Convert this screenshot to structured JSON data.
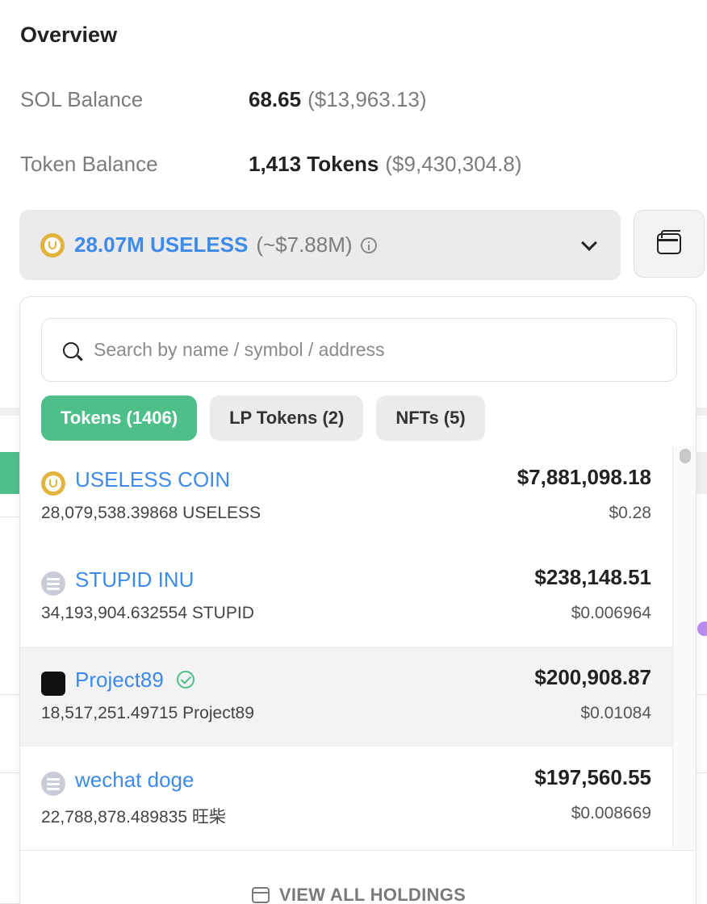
{
  "overview": {
    "title": "Overview",
    "sol_label": "SOL Balance",
    "sol_value": "68.65",
    "sol_usd": "($13,963.13)",
    "token_label": "Token Balance",
    "token_value": "1,413 Tokens",
    "token_usd": "($9,430,304.8)"
  },
  "selector": {
    "amount": "28.07M USELESS",
    "usd": "(~$7.88M)",
    "icon": "useless-coin-icon"
  },
  "dropdown": {
    "search_placeholder": "Search by name / symbol / address",
    "tabs": [
      {
        "label": "Tokens (1406)",
        "active": true
      },
      {
        "label": "LP Tokens (2)",
        "active": false
      },
      {
        "label": "NFTs (5)",
        "active": false
      }
    ],
    "items": [
      {
        "name": "USELESS COIN",
        "amount": "28,079,538.39868 USELESS",
        "usd": "$7,881,098.18",
        "price": "$0.28",
        "icon": "useless-coin-icon"
      },
      {
        "name": "STUPID INU",
        "amount": "34,193,904.632554 STUPID",
        "usd": "$238,148.51",
        "price": "$0.006964",
        "icon": "generic-token-icon"
      },
      {
        "name": "Project89",
        "amount": "18,517,251.49715 Project89",
        "usd": "$200,908.87",
        "price": "$0.01084",
        "icon": "project89-icon",
        "verified": true
      },
      {
        "name": "wechat doge",
        "amount": "22,788,878.489835 旺柴",
        "usd": "$197,560.55",
        "price": "$0.008669",
        "icon": "generic-token-icon"
      }
    ],
    "footer_label": "VIEW ALL HOLDINGS"
  },
  "colors": {
    "accent_green": "#4fbf8a",
    "link_blue": "#3d8ae8",
    "coin_gold": "#e2b43c"
  }
}
